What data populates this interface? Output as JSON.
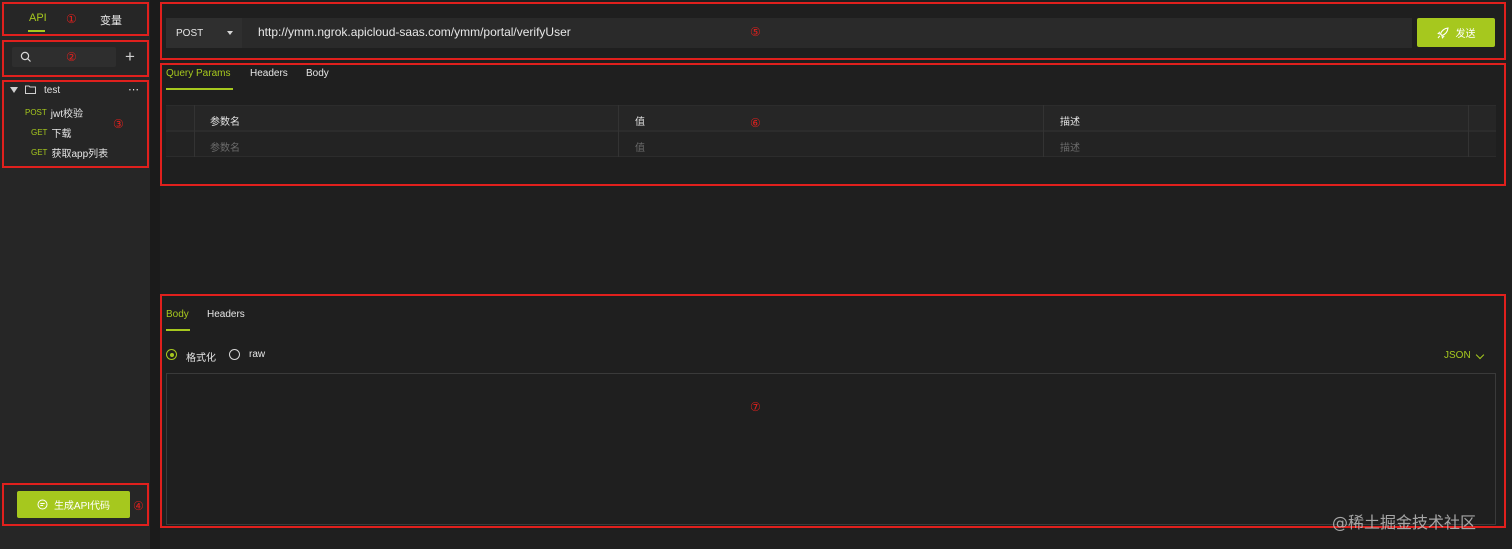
{
  "sidebar": {
    "tabs": {
      "api": "API",
      "variables": "变量"
    },
    "folder": {
      "name": "test"
    },
    "items": [
      {
        "method": "POST",
        "name": "jwt校验"
      },
      {
        "method": "GET",
        "name": "下载"
      },
      {
        "method": "GET",
        "name": "获取app列表"
      }
    ],
    "generate_button": "生成API代码"
  },
  "request": {
    "method": "POST",
    "url": "http://ymm.ngrok.apicloud-saas.com/ymm/portal/verifyUser",
    "send_label": "发送",
    "tabs": [
      "Query Params",
      "Headers",
      "Body"
    ],
    "params_table": {
      "headers": [
        "参数名",
        "值",
        "描述"
      ],
      "placeholders": [
        "参数名",
        "值",
        "描述"
      ]
    }
  },
  "response": {
    "tabs": [
      "Body",
      "Headers"
    ],
    "format_options": [
      "格式化",
      "raw"
    ],
    "format_selected": "格式化",
    "content_type": "JSON"
  },
  "annotations": [
    "①",
    "②",
    "③",
    "④",
    "⑤",
    "⑥",
    "⑦"
  ],
  "watermark": "@稀土掘金技术社区",
  "colors": {
    "accent": "#a6c81e",
    "annotation": "#e0201d",
    "background": "#1f1f1f",
    "sidebar": "#262626"
  }
}
